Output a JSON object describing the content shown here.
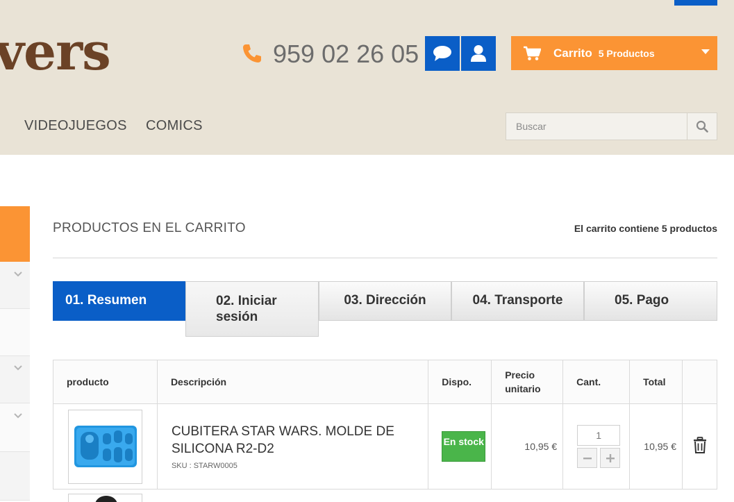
{
  "header": {
    "logo_text": "vers",
    "phone": "959 02 26 05",
    "cart_label": "Carrito",
    "cart_count": "5 Productos",
    "nav": [
      "VIDEOJUEGOS",
      "COMICS"
    ],
    "search_placeholder": "Buscar"
  },
  "main": {
    "title": "PRODUCTOS EN EL CARRITO",
    "summary": "El carrito contiene 5 productos",
    "steps": [
      "01. Resumen",
      "02. Iniciar sesión",
      "03. Dirección",
      "04. Transporte",
      "05. Pago"
    ],
    "table": {
      "headers": {
        "product": "producto",
        "description": "Descripción",
        "availability": "Dispo.",
        "unit_price": "Precio unitario",
        "quantity": "Cant.",
        "total": "Total"
      },
      "rows": [
        {
          "name": "CUBITERA STAR WARS. MOLDE DE SILICONA R2-D2",
          "sku": "SKU : STARW0005",
          "stock": "En stock",
          "unit_price": "10,95 €",
          "quantity": "1",
          "total": "10,95 €"
        }
      ]
    }
  },
  "colors": {
    "brand_blue": "#0a5ec7",
    "accent_orange": "#fb9434",
    "header_bg": "#e9e3d6",
    "stock_green": "#4ab54a"
  },
  "icons": [
    "phone-icon",
    "chat-icon",
    "user-icon",
    "cart-icon",
    "chevron-down-icon",
    "search-icon",
    "trash-icon",
    "minus-icon",
    "plus-icon"
  ]
}
